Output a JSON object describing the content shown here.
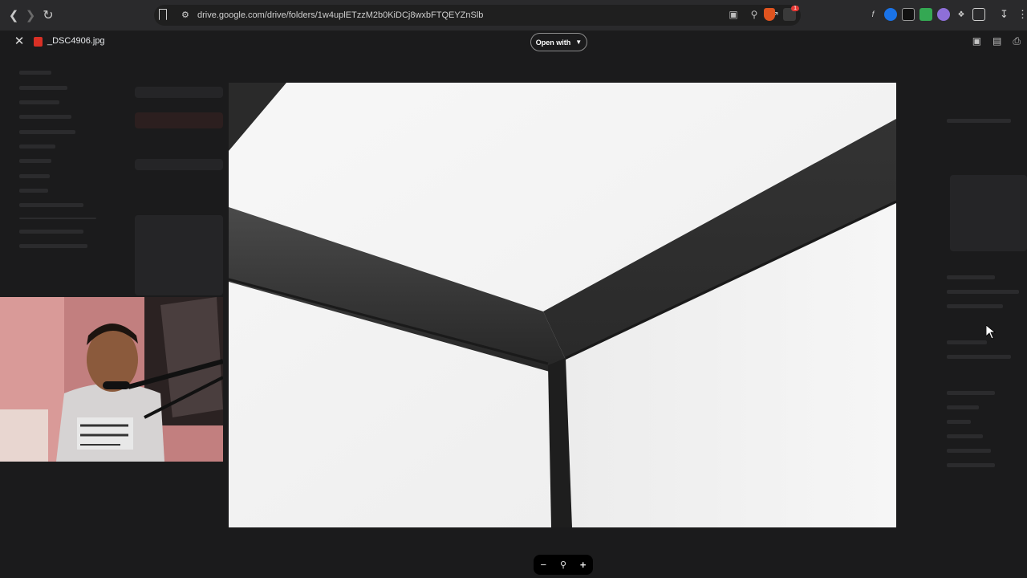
{
  "browser": {
    "url": "drive.google.com/drive/folders/1w4uplETzzM2b0KiDCj8wxbFTQEYZnSlb",
    "back_icon": "arrow-left-icon",
    "forward_icon": "arrow-right-icon",
    "reload_icon": "reload-icon",
    "extension_badge": "1"
  },
  "viewer": {
    "file_name": "_DSC4906.jpg",
    "open_with_label": "Open with"
  },
  "zoom": {
    "zoom_out_label": "−",
    "zoom_in_label": "+"
  },
  "colors": {
    "viewer_bg": "#1b1b1c",
    "browser_bar": "#2a2a2c",
    "file_icon": "#d93025"
  }
}
